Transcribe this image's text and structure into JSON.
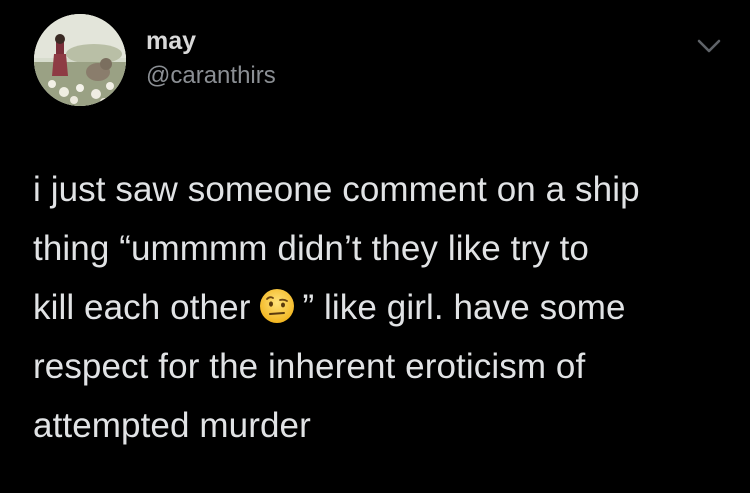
{
  "author": {
    "name": "may",
    "handle": "@caranthirs",
    "avatar_icon": "profile-photo-avatar"
  },
  "menu": {
    "icon": "chevron-down-icon"
  },
  "tweet": {
    "line1": "i just saw someone comment on a ship",
    "line2": "thing “ummmm didn’t they like try to",
    "line3_before_emoji": "kill each other",
    "emoji": "face-with-raised-eyebrow-emoji",
    "line3_after_emoji": "” like girl. have some",
    "line4": "respect for the inherent eroticism of",
    "line5": "attempted murder"
  },
  "colors": {
    "background": "#000000",
    "text": "#e1e3e5",
    "handle": "#8b8f94",
    "chevron": "#5f6368"
  }
}
